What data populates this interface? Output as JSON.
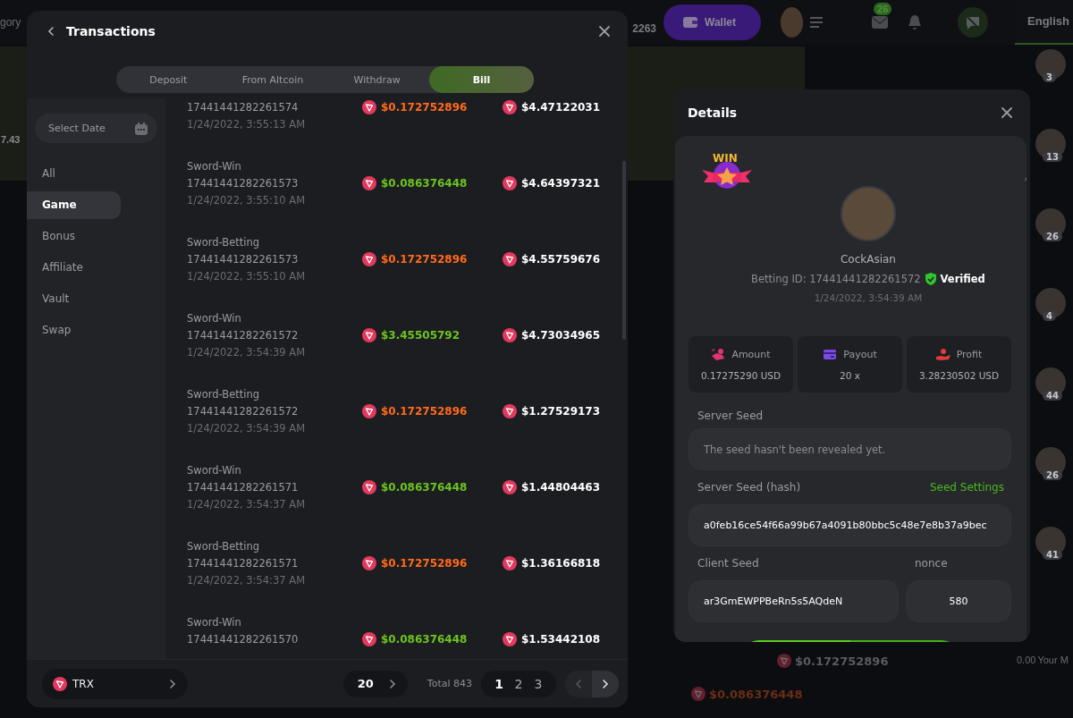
{
  "background": {
    "header": {
      "category_text": "gory",
      "balance": "2263",
      "wallet_button": "Wallet",
      "mail_badge": "26",
      "language": "English"
    },
    "game_value": "7.43",
    "rail_levels": [
      "3",
      "13",
      "26",
      "4",
      "44",
      "26",
      "41"
    ],
    "feed": [
      {
        "amount": "$0.172752896",
        "kind": "muted"
      },
      {
        "amount": "$0.086376448",
        "kind": "loss"
      }
    ],
    "feed_value": "0.00",
    "feed_label": "Your M"
  },
  "transactions": {
    "title": "Transactions",
    "tabs": [
      {
        "label": "Deposit",
        "selected": false
      },
      {
        "label": "From Altcoin",
        "selected": false
      },
      {
        "label": "Withdraw",
        "selected": false
      },
      {
        "label": "Bill",
        "selected": true
      }
    ],
    "date_filter": {
      "placeholder": "Select Date"
    },
    "categories": [
      {
        "label": "All",
        "selected": false
      },
      {
        "label": "Game",
        "selected": true
      },
      {
        "label": "Bonus",
        "selected": false
      },
      {
        "label": "Affiliate",
        "selected": false
      },
      {
        "label": "Vault",
        "selected": false
      },
      {
        "label": "Swap",
        "selected": false
      }
    ],
    "rows": [
      {
        "id": "17441441282261574",
        "date": "1/24/2022, 3:55:13 AM",
        "amount": "$0.172752896",
        "color": "#ff6a1a",
        "balance": "$4.47122031"
      },
      {
        "title": "Sword-Win",
        "id": "17441441282261573",
        "date": "1/24/2022, 3:55:10 AM",
        "amount": "$0.086376448",
        "color": "#6cc41f",
        "balance": "$4.64397321"
      },
      {
        "title": "Sword-Betting",
        "id": "17441441282261573",
        "date": "1/24/2022, 3:55:10 AM",
        "amount": "$0.172752896",
        "color": "#ff6a1a",
        "balance": "$4.55759676"
      },
      {
        "title": "Sword-Win",
        "id": "17441441282261572",
        "date": "1/24/2022, 3:54:39 AM",
        "amount": "$3.45505792",
        "color": "#6cc41f",
        "balance": "$4.73034965"
      },
      {
        "title": "Sword-Betting",
        "id": "17441441282261572",
        "date": "1/24/2022, 3:54:39 AM",
        "amount": "$0.172752896",
        "color": "#ff6a1a",
        "balance": "$1.27529173"
      },
      {
        "title": "Sword-Win",
        "id": "17441441282261571",
        "date": "1/24/2022, 3:54:37 AM",
        "amount": "$0.086376448",
        "color": "#6cc41f",
        "balance": "$1.44804463"
      },
      {
        "title": "Sword-Betting",
        "id": "17441441282261571",
        "date": "1/24/2022, 3:54:37 AM",
        "amount": "$0.172752896",
        "color": "#ff6a1a",
        "balance": "$1.36166818"
      },
      {
        "title": "Sword-Win",
        "id": "17441441282261570",
        "amount": "$0.086376448",
        "color": "#6cc41f",
        "balance": "$1.53442108"
      }
    ],
    "footer": {
      "currency": "TRX",
      "page_size": "20",
      "total": "Total 843",
      "pages": [
        {
          "label": "1",
          "selected": true
        },
        {
          "label": "2",
          "selected": false
        },
        {
          "label": "3",
          "selected": false
        }
      ],
      "prev_disabled": true
    }
  },
  "details": {
    "title": "Details",
    "badge": "WIN",
    "username": "CockAsian",
    "betting_id": "Betting ID: 17441441282261572",
    "verified": "Verified",
    "date": "1/24/2022, 3:54:39 AM",
    "stats": [
      {
        "kind": "amount",
        "label": "Amount",
        "value": "0.17275290 USD"
      },
      {
        "kind": "payout",
        "label": "Payout",
        "value": "20 x"
      },
      {
        "kind": "profit",
        "label": "Profit",
        "value": "3.28230502 USD"
      }
    ],
    "server_seed": {
      "label": "Server Seed",
      "placeholder": "The seed hasn't been revealed yet."
    },
    "server_seed_hash": {
      "label": "Server Seed (hash)",
      "link": "Seed Settings",
      "value": "a0feb16ce54f66a99b67a4091b80bbc5c48e7e8b37a9bec"
    },
    "client_seed": {
      "label": "Client Seed",
      "value": "ar3GmEWPPBeRn5s5AQdeN"
    },
    "nonce": {
      "label": "nonce",
      "value": "580"
    }
  }
}
